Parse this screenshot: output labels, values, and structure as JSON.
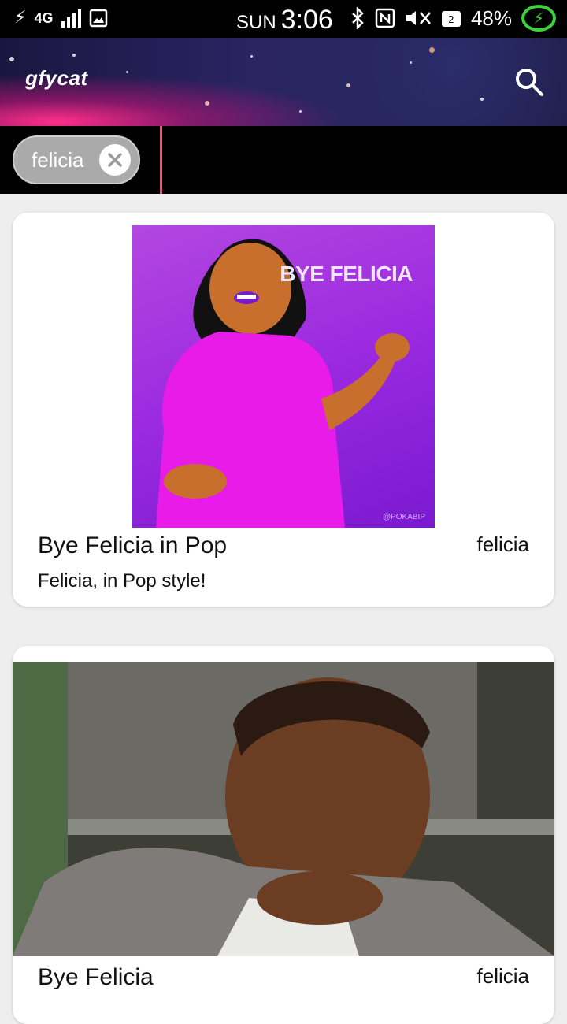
{
  "status_bar": {
    "left_icons": [
      "charging-icon",
      "4g-signal-icon",
      "image-notification-icon"
    ],
    "network_label": "4G",
    "day": "SUN",
    "time": "3:06",
    "right_icons": [
      "bluetooth-icon",
      "nfc-icon",
      "mute-icon",
      "wifi-calling-icon",
      "battery-charging-icon"
    ],
    "battery_percent": "48%"
  },
  "header": {
    "logo": "gfycat",
    "search_icon": "search-icon"
  },
  "search": {
    "chip_label": "felicia",
    "clear_icon": "close-icon"
  },
  "results": [
    {
      "title": "Bye Felicia in Pop",
      "description": "Felicia, in Pop style!",
      "tag": "felicia",
      "image_text": "BYE FELICIA",
      "image_credit": "@POKABIP"
    },
    {
      "title": "Bye Felicia",
      "description": "",
      "tag": "felicia"
    }
  ],
  "colors": {
    "accent": "#ff4f7a",
    "pop_bg": "#9b2ae0"
  }
}
